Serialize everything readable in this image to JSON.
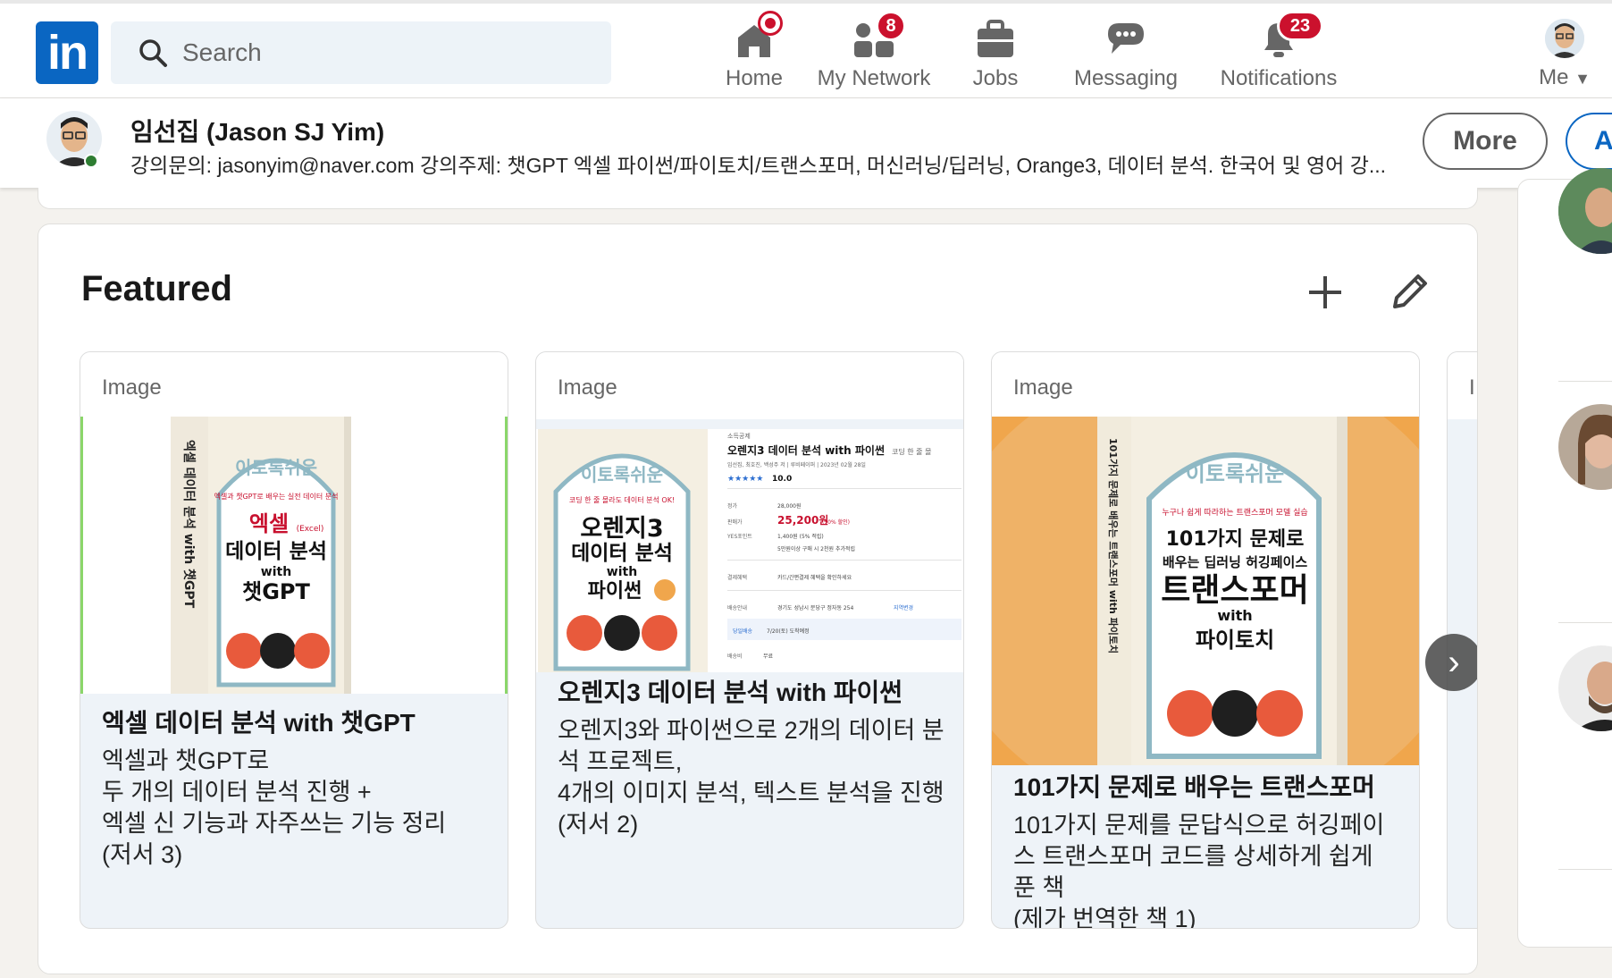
{
  "nav": {
    "logo": "in",
    "search_placeholder": "Search",
    "items": [
      {
        "label": "Home",
        "badge": ""
      },
      {
        "label": "My Network",
        "badge": "8"
      },
      {
        "label": "Jobs",
        "badge": ""
      },
      {
        "label": "Messaging",
        "badge": ""
      },
      {
        "label": "Notifications",
        "badge": "23"
      },
      {
        "label": "Me",
        "badge": ""
      }
    ]
  },
  "profile": {
    "name": "임선집 (Jason SJ Yim)",
    "headline": "강의문의: jasonyim@naver.com 강의주제: 챗GPT 엑셀 파이썬/파이토치/트랜스포머, 머신러닝/딥러닝, Orange3, 데이터 분석. 한국어 및 영어 강...",
    "more_label": "More",
    "second_button_label": "A"
  },
  "featured": {
    "title": "Featured",
    "items": [
      {
        "type": "Image",
        "title": "엑셀 데이터 분석 with 챗GPT",
        "description": "엑셀과 챗GPT로\n두 개의 데이터 분석 진행 +\n엑셀 신 기능과 자주쓰는 기능 정리\n(저서 3)",
        "book": {
          "series": "이토록쉬운",
          "tagline": "엑셀과 챗GPT로 배우는 실전 데이터 분석",
          "line1": "엑셀",
          "line1_suffix": "(Excel)",
          "line2": "데이터 분석",
          "line3": "with",
          "line4": "챗GPT",
          "spine": "엑셀 데이터 분석 with 챗GPT"
        }
      },
      {
        "type": "Image",
        "title": "오렌지3 데이터 분석 with 파이썬",
        "description": "오렌지3와 파이썬으로 2개의 데이터 분석 프로젝트,\n4개의 이미지 분석, 텍스트 분석을 진행\n(저서 2)",
        "book": {
          "series": "이토록쉬운",
          "tagline": "코딩 한 줄 몰라도 데이터 분석 OK!",
          "line1": "오렌지3",
          "line2": "데이터 분석",
          "line3": "with",
          "line4": "파이썬"
        },
        "store": {
          "category": "소득공제",
          "title": "오렌지3 데이터 분석 with 파이썬",
          "title_suffix": "코딩 한 줄 몰",
          "meta": "임선집, 최호진, 백성주 저 | 루비페이퍼 | 2023년 02월 28일",
          "rating": "10.0",
          "list_price_label": "정가",
          "list_price": "28,000원",
          "sale_label": "판매가",
          "sale_price": "25,200원",
          "discount": "(10% 할인)",
          "points_label": "YES포인트",
          "points": "1,400원 (5% 적립)",
          "event": "5만원이상 구매 시 2천원 추가적립",
          "benefit_label": "결제혜택",
          "benefit": "카드/간편결제 혜택을 확인하세요",
          "delivery_label": "배송안내",
          "delivery": "경기도 성남시 분당구 정자동 254",
          "delivery_link": "지역변경",
          "arrival": "7/20(토) 도착예정",
          "arrival_label": "당일배송",
          "shipping_label": "배송비",
          "shipping": "무료"
        }
      },
      {
        "type": "Image",
        "title": "101가지 문제로 배우는 트랜스포머",
        "description": "101가지 문제를 문답식으로 허깅페이스 트랜스포머 코드를 상세하게 쉽게 푼 책\n(제가 번역한 책 1)",
        "book": {
          "series": "이토록쉬운",
          "tagline": "누구나 쉽게 따라하는 트랜스포머 모델 실습",
          "line1": "101가지 문제로",
          "line2": "배우는 딥러닝 허깅페이스",
          "line3": "트랜스포머",
          "line4": "with",
          "line5": "파이토치",
          "spine": "101가지 문제로 배우는 트랜스포머 with 파이토치"
        }
      },
      {
        "type": "I",
        "title": "",
        "description": ""
      }
    ]
  },
  "colors": {
    "brand": "#0a66c2",
    "badge": "#cb112d",
    "online": "#2e7d32",
    "book_cream": "#f4efe2",
    "book_frame": "#8fb8c4",
    "book_red": "#c8102e",
    "book_orange": "#f0a64c"
  }
}
